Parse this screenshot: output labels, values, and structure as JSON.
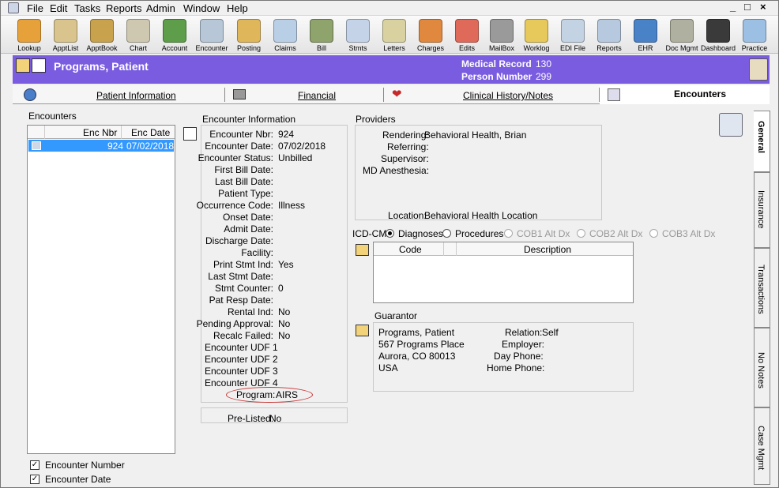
{
  "menu": [
    "File",
    "Edit",
    "Tasks",
    "Reports",
    "Admin",
    "Window",
    "Help"
  ],
  "window_controls": [
    "_",
    "□",
    "×"
  ],
  "toolbar": [
    {
      "label": "Lookup",
      "icon": "magnifier-person-icon",
      "color": "#e7a13a"
    },
    {
      "label": "ApptList",
      "icon": "appt-list-icon",
      "color": "#d8c48c"
    },
    {
      "label": "ApptBook",
      "icon": "appt-book-icon",
      "color": "#c9a24d"
    },
    {
      "label": "Chart",
      "icon": "chart-clipboard-icon",
      "color": "#cfc8b0"
    },
    {
      "label": "Account",
      "icon": "account-icon",
      "color": "#5e9e4a"
    },
    {
      "label": "Encounter",
      "icon": "encounter-icon",
      "color": "#b7c7d8"
    },
    {
      "label": "Posting",
      "icon": "posting-icon",
      "color": "#e0b65a"
    },
    {
      "label": "Claims",
      "icon": "claims-icon",
      "color": "#b9cfe6"
    },
    {
      "label": "Bill",
      "icon": "bill-register-icon",
      "color": "#8fa36d"
    },
    {
      "label": "Stmts",
      "icon": "statements-icon",
      "color": "#c5d3e8"
    },
    {
      "label": "Letters",
      "icon": "letters-icon",
      "color": "#d9d2a0"
    },
    {
      "label": "Charges",
      "icon": "charges-icon",
      "color": "#e0883e"
    },
    {
      "label": "Edits",
      "icon": "lifebuoy-icon",
      "color": "#e06a5a"
    },
    {
      "label": "MailBox",
      "icon": "mailbox-icon",
      "color": "#9a9a9a"
    },
    {
      "label": "Worklog",
      "icon": "worklog-icon",
      "color": "#e6c95a"
    },
    {
      "label": "EDI File",
      "icon": "edi-file-icon",
      "color": "#c3d3e4"
    },
    {
      "label": "Reports",
      "icon": "reports-icon",
      "color": "#b6c9de"
    },
    {
      "label": "EHR",
      "icon": "ehr-globe-icon",
      "color": "#4a82c8"
    },
    {
      "label": "Doc Mgmt",
      "icon": "doc-mgmt-icon",
      "color": "#b0b0a0"
    },
    {
      "label": "Dashboard",
      "icon": "dashboard-icon",
      "color": "#3a3a3a"
    },
    {
      "label": "Practice",
      "icon": "practice-icon",
      "color": "#9cc0e4"
    }
  ],
  "header": {
    "patient_name": "Programs, Patient",
    "medical_record_label": "Medical Record",
    "medical_record_value": "130",
    "person_number_label": "Person Number",
    "person_number_value": "299"
  },
  "tabs": [
    "Patient Information",
    "Financial",
    "Clinical History/Notes",
    "Encounters"
  ],
  "encounters_panel": {
    "title": "Encounters",
    "col_nbr": "Enc Nbr",
    "col_date": "Enc Date",
    "rows": [
      {
        "nbr": "924",
        "date": "07/02/2018"
      }
    ],
    "check_number": "Encounter Number",
    "check_date": "Encounter Date"
  },
  "encounter_info": {
    "title": "Encounter Information",
    "fields": [
      {
        "label": "Encounter Nbr:",
        "value": "924"
      },
      {
        "label": "Encounter Date:",
        "value": "07/02/2018"
      },
      {
        "label": "Encounter Status:",
        "value": "Unbilled"
      },
      {
        "label": "First Bill Date:",
        "value": ""
      },
      {
        "label": "Last Bill Date:",
        "value": ""
      },
      {
        "label": "Patient Type:",
        "value": ""
      },
      {
        "label": "Occurrence Code:",
        "value": "Illness"
      },
      {
        "label": "Onset Date:",
        "value": ""
      },
      {
        "label": "Admit Date:",
        "value": ""
      },
      {
        "label": "Discharge Date:",
        "value": ""
      },
      {
        "label": "Facility:",
        "value": ""
      },
      {
        "label": "Print Stmt Ind:",
        "value": "Yes"
      },
      {
        "label": "Last Stmt Date:",
        "value": ""
      },
      {
        "label": "Stmt Counter:",
        "value": "0"
      },
      {
        "label": "Pat Resp Date:",
        "value": ""
      },
      {
        "label": "Rental Ind:",
        "value": "No"
      },
      {
        "label": "Pending Approval:",
        "value": "No"
      },
      {
        "label": "Recalc Failed:",
        "value": "No"
      }
    ],
    "udf": [
      "Encounter UDF 1",
      "Encounter UDF 2",
      "Encounter UDF 3",
      "Encounter UDF 4"
    ],
    "program_label": "Program:",
    "program_value": "AIRS",
    "prelisted_label": "Pre-Listed:",
    "prelisted_value": "No"
  },
  "providers": {
    "title": "Providers",
    "rendering_label": "Rendering:",
    "rendering_value": "Behavioral Health, Brian",
    "referring_label": "Referring:",
    "supervisor_label": "Supervisor:",
    "anesthesia_label": "MD Anesthesia:",
    "location_label": "Location:",
    "location_value": "Behavioral Health Location"
  },
  "icd": {
    "label": "ICD-CM",
    "options": [
      "Diagnoses",
      "Procedures",
      "COB1 Alt Dx",
      "COB2 Alt Dx",
      "COB3 Alt Dx"
    ],
    "col_code": "Code",
    "col_desc": "Description"
  },
  "guarantor": {
    "title": "Guarantor",
    "lines": [
      "Programs, Patient",
      "567 Programs Place",
      "Aurora, CO 80013",
      "USA"
    ],
    "relation_label": "Relation:",
    "relation_value": "Self",
    "employer_label": "Employer:",
    "dayphone_label": "Day Phone:",
    "homephone_label": "Home Phone:"
  },
  "side_tabs": [
    "General",
    "Insurance",
    "Transactions",
    "No Notes",
    "Case Mgmt"
  ]
}
